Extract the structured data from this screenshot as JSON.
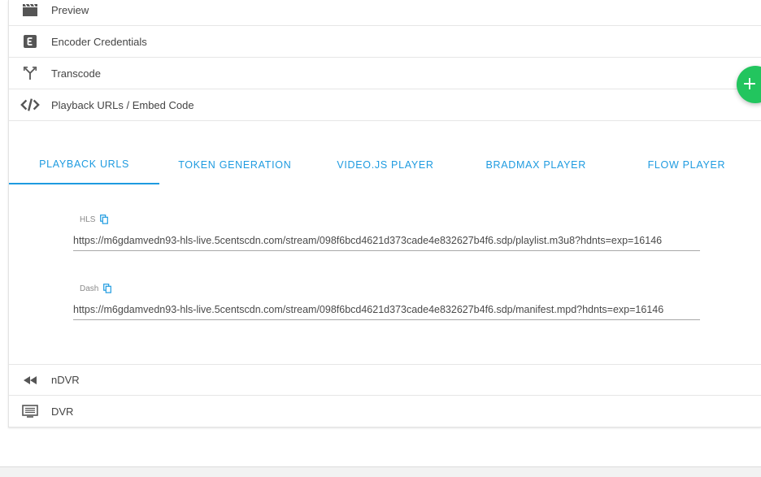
{
  "menu": {
    "preview": "Preview",
    "encoder_credentials": "Encoder Credentials",
    "transcode": "Transcode",
    "playback": "Playback URLs / Embed Code",
    "ndvr": "nDVR",
    "dvr": "DVR"
  },
  "icons": {
    "preview": "clapperboard-icon",
    "encoder_credentials": "letter-e-box-icon",
    "transcode": "fork-arrows-icon",
    "playback": "code-brackets-icon",
    "ndvr": "rewind-icon",
    "dvr": "monitor-list-icon",
    "copy": "copy-icon",
    "fab": "plus-icon"
  },
  "tabs": [
    {
      "label": "PLAYBACK URLS",
      "active": true
    },
    {
      "label": "TOKEN GENERATION",
      "active": false
    },
    {
      "label": "VIDEO.JS PLAYER",
      "active": false
    },
    {
      "label": "BRADMAX PLAYER",
      "active": false
    },
    {
      "label": "FLOW PLAYER",
      "active": false
    }
  ],
  "fields": {
    "hls": {
      "label": "HLS",
      "value": "https://m6gdamvedn93-hls-live.5centscdn.com/stream/098f6bcd4621d373cade4e832627b4f6.sdp/playlist.m3u8?hdnts=exp=16146"
    },
    "dash": {
      "label": "Dash",
      "value": "https://m6gdamvedn93-hls-live.5centscdn.com/stream/098f6bcd4621d373cade4e832627b4f6.sdp/manifest.mpd?hdnts=exp=16146"
    }
  },
  "colors": {
    "accent": "#1e9be0",
    "fab": "#22c55e",
    "icon": "#555555"
  }
}
